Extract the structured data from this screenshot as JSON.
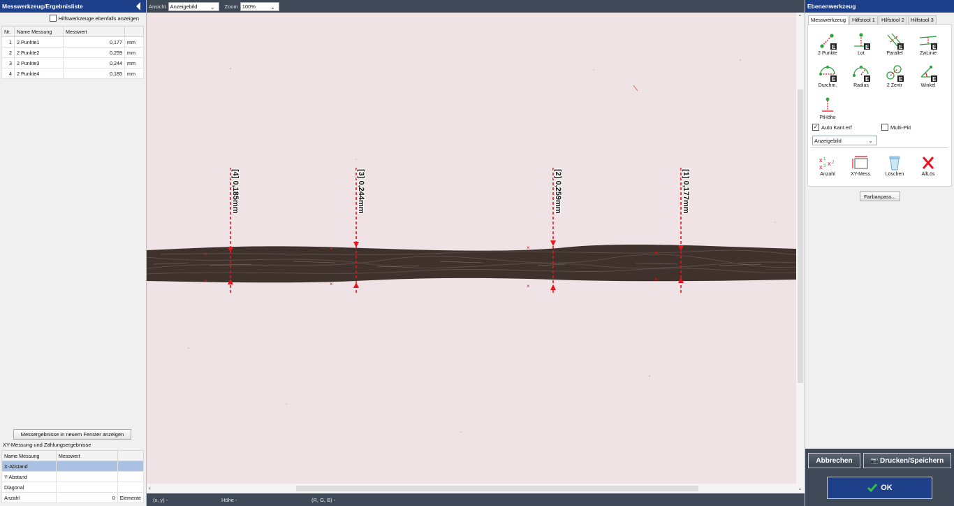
{
  "left_panel": {
    "title": "Messwerkzeug/Ergebnisliste",
    "show_aux_label": "Hilfswerkzeuge ebenfalls anzeigen",
    "results_columns": [
      "Nr.",
      "Name Messung",
      "Messwert",
      ""
    ],
    "results": [
      {
        "nr": "1",
        "name": "2 Punkte1",
        "value": "0,177",
        "unit": "mm"
      },
      {
        "nr": "2",
        "name": "2 Punkte2",
        "value": "0,259",
        "unit": "mm"
      },
      {
        "nr": "3",
        "name": "2 Punkte3",
        "value": "0,244",
        "unit": "mm"
      },
      {
        "nr": "4",
        "name": "2 Punkte4",
        "value": "0,185",
        "unit": "mm"
      }
    ],
    "show_window_button": "Messergebnisse in neuem Fenster anzeigen",
    "xy_caption": "XY-Messung und Zählungsergebnisse",
    "xy_columns": [
      "Name Messung",
      "Messwert",
      ""
    ],
    "xy_rows": [
      {
        "name": "X-Abstand",
        "value": "",
        "unit": ""
      },
      {
        "name": "Y-Abstand",
        "value": "",
        "unit": ""
      },
      {
        "name": "Diagonal",
        "value": "",
        "unit": ""
      },
      {
        "name": "Anzahl",
        "value": "0",
        "unit": "Elemente"
      }
    ]
  },
  "toolbar": {
    "view_label": "Ansicht",
    "view_value": "Anzeigebild",
    "zoom_label": "Zoom",
    "zoom_value": "100%"
  },
  "measurements": [
    {
      "label": "[4] 0,185mm"
    },
    {
      "label": "[3] 0,244mm"
    },
    {
      "label": "[2] 0,259mm"
    },
    {
      "label": "[1] 0,177mm"
    }
  ],
  "status": {
    "xy": "(x, y)  -",
    "height": "Höhe  -",
    "rgb": "(R, G, B)  -"
  },
  "right_panel": {
    "title": "Ebenenwerkzeug",
    "tabs": [
      "Messwerkzeug",
      "Hilfstool 1",
      "Hilfstool 2",
      "Hilfstool 3"
    ],
    "tools": [
      {
        "label": "2 Punkte",
        "icon": "two-points-icon"
      },
      {
        "label": "Lot",
        "icon": "perpendicular-icon"
      },
      {
        "label": "Parallel",
        "icon": "parallel-icon"
      },
      {
        "label": "ZwLinie",
        "icon": "between-lines-icon"
      },
      {
        "label": "Durchm.",
        "icon": "diameter-icon"
      },
      {
        "label": "Radius",
        "icon": "radius-icon"
      },
      {
        "label": "2 Zentr",
        "icon": "two-centers-icon"
      },
      {
        "label": "Winkel",
        "icon": "angle-icon"
      },
      {
        "label": "PtHöhe",
        "icon": "point-height-icon"
      }
    ],
    "auto_edge_label": "Auto Kant.erf",
    "multi_point_label": "Multi-Pkt",
    "image_select_value": "Anzeigebild",
    "actions": [
      {
        "label": "Anzahl",
        "icon": "count-icon"
      },
      {
        "label": "XY-Mess.",
        "icon": "xy-measure-icon"
      },
      {
        "label": "Löschen",
        "icon": "trash-icon"
      },
      {
        "label": "AllLös",
        "icon": "delete-all-icon"
      }
    ],
    "color_adjust_button": "Farbanpass...",
    "cancel_button": "Abbrechen",
    "print_save_button": "Drucken/Speichern",
    "ok_button": "OK"
  },
  "colors": {
    "title_bar": "#1e3f8a",
    "dark_chrome": "#3f4856",
    "measure_red": "#e8141e",
    "tool_green": "#2aa43c",
    "image_background": "#efe3e6",
    "fiber": "#3d302b"
  }
}
